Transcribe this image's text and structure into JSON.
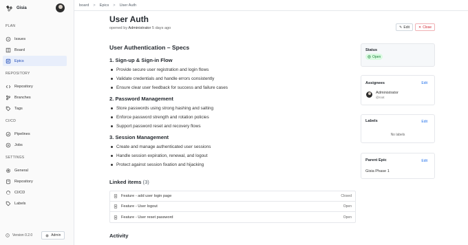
{
  "app": {
    "name": "Gisia"
  },
  "sidebar": {
    "sections": [
      {
        "title": "PLAN",
        "items": [
          {
            "label": "Issues",
            "icon": "issues-icon"
          },
          {
            "label": "Board",
            "icon": "board-icon"
          },
          {
            "label": "Epics",
            "icon": "epics-icon",
            "active": true
          }
        ]
      },
      {
        "title": "REPOSITORY",
        "items": [
          {
            "label": "Repository",
            "icon": "code-icon"
          },
          {
            "label": "Branches",
            "icon": "branch-icon"
          },
          {
            "label": "Tags",
            "icon": "tag-icon"
          }
        ]
      },
      {
        "title": "CI/CD",
        "items": [
          {
            "label": "Pipelines",
            "icon": "pipeline-icon"
          },
          {
            "label": "Jobs",
            "icon": "jobs-icon"
          }
        ]
      },
      {
        "title": "SETTINGS",
        "items": [
          {
            "label": "General",
            "icon": "gear-icon"
          },
          {
            "label": "Repository",
            "icon": "repository-settings-icon"
          },
          {
            "label": "CI/CD",
            "icon": "cicd-settings-icon"
          },
          {
            "label": "Labels",
            "icon": "label-icon"
          }
        ]
      }
    ],
    "version": "Version 0.2.0",
    "admin_label": "Admin"
  },
  "breadcrumb": {
    "items": [
      "board",
      "Epics"
    ],
    "current": "User Auth"
  },
  "epic": {
    "title": "User Auth",
    "meta_prefix": "opened by",
    "author": "Administrator",
    "age": "5 days ago",
    "edit_label": "Edit",
    "close_label": "Close"
  },
  "description": {
    "heading": "User Authentication – Specs",
    "sections": [
      {
        "title": "1. Sign-up & Sign-in Flow",
        "items": [
          "Provide secure user registration and login flows",
          "Validate credentials and handle errors consistently",
          "Ensure clear user feedback for success and failure cases"
        ]
      },
      {
        "title": "2. Password Management",
        "items": [
          "Store passwords using strong hashing and salting",
          "Enforce password strength and rotation policies",
          "Support password reset and recovery flows"
        ]
      },
      {
        "title": "3. Session Management",
        "items": [
          "Create and manage authenticated user sessions",
          "Handle session expiration, renewal, and logout",
          "Protect against session fixation and hijacking"
        ]
      }
    ]
  },
  "linked_items": {
    "title": "Linked items",
    "count": "(3)",
    "rows": [
      {
        "name": "Feature - add user login page",
        "state": "Closed"
      },
      {
        "name": "Feature - User logout",
        "state": "Open"
      },
      {
        "name": "Feature - User reset password",
        "state": "Open"
      }
    ]
  },
  "activity": {
    "title": "Activity"
  },
  "side": {
    "status_title": "Status",
    "status_value": "Open",
    "assignees_title": "Assignees",
    "assignee_name": "Administrator",
    "assignee_handle": "@root",
    "labels_title": "Labels",
    "no_labels": "No labels",
    "parent_title": "Parent Epic",
    "parent_name": "Gisia Phase 1",
    "edit_label": "Edit"
  },
  "colors": {
    "accent": "#1f6feb",
    "active_bg": "#e8eefb",
    "danger": "#cf222e",
    "success": "#1a7f37"
  }
}
